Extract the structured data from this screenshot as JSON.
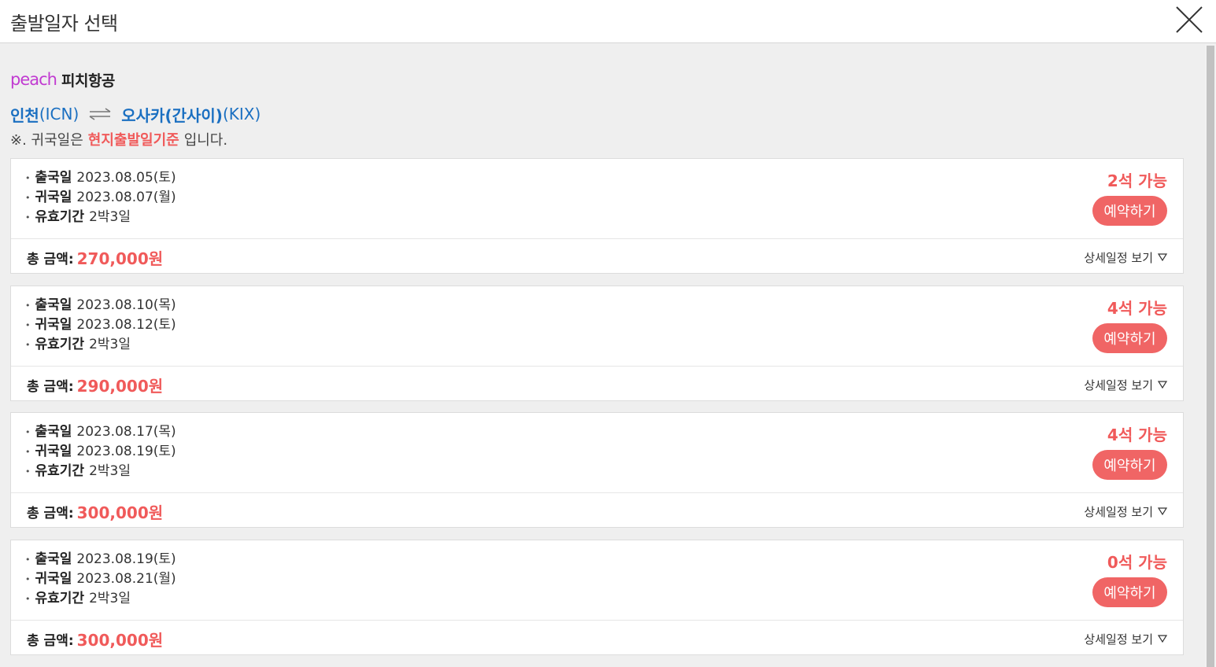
{
  "header": {
    "title": "출발일자 선택",
    "close_icon": "close-icon"
  },
  "airline": {
    "logo_text": "peach",
    "name": "피치항공"
  },
  "route": {
    "origin_city": "인천",
    "origin_code": "(ICN)",
    "arrow_icon": "round-trip-arrows-icon",
    "dest_city": "오사카(간사이)",
    "dest_code": "(KIX)"
  },
  "notice": {
    "prefix": "※. 귀국일은",
    "highlight": "현지출발일기준",
    "suffix": "입니다."
  },
  "labels": {
    "depart": "출국일",
    "return": "귀국일",
    "duration": "유효기간",
    "total": "총 금액:",
    "reserve": "예약하기",
    "detail": "상세일정 보기"
  },
  "colors": {
    "accent": "#f05a5a",
    "route": "#1a6fc1",
    "logo": "#c13bd1"
  },
  "offers": [
    {
      "depart": "2023.08.05(토)",
      "return": "2023.08.07(월)",
      "duration": "2박3일",
      "seats": "2석 가능",
      "total": "270,000원"
    },
    {
      "depart": "2023.08.10(목)",
      "return": "2023.08.12(토)",
      "duration": "2박3일",
      "seats": "4석 가능",
      "total": "290,000원"
    },
    {
      "depart": "2023.08.17(목)",
      "return": "2023.08.19(토)",
      "duration": "2박3일",
      "seats": "4석 가능",
      "total": "300,000원"
    },
    {
      "depart": "2023.08.19(토)",
      "return": "2023.08.21(월)",
      "duration": "2박3일",
      "seats": "0석 가능",
      "total": "300,000원"
    }
  ]
}
